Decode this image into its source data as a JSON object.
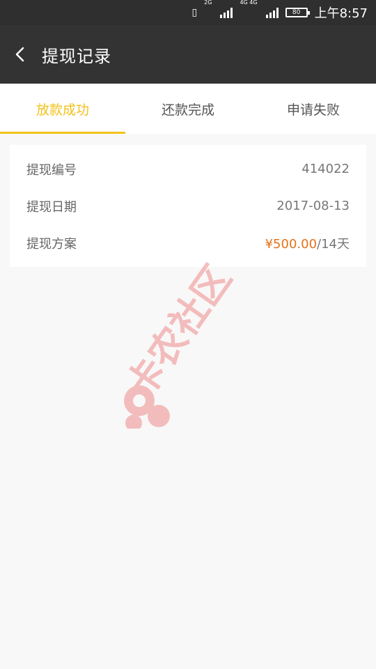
{
  "status_bar": {
    "net1": "2G",
    "net2": "4G 4G",
    "battery": "80",
    "time": "上午8:57"
  },
  "header": {
    "title": "提现记录"
  },
  "tabs": [
    {
      "label": "放款成功",
      "active": true
    },
    {
      "label": "还款完成",
      "active": false
    },
    {
      "label": "申请失败",
      "active": false
    }
  ],
  "record": {
    "id_label": "提现编号",
    "id_value": "414022",
    "date_label": "提现日期",
    "date_value": "2017-08-13",
    "plan_label": "提现方案",
    "plan_amount": "¥500.00",
    "plan_term": "/14天"
  },
  "watermark": {
    "text": "卡农社区"
  },
  "colors": {
    "accent": "#f2c21a",
    "price": "#e4721a",
    "header_bg": "#333333"
  }
}
